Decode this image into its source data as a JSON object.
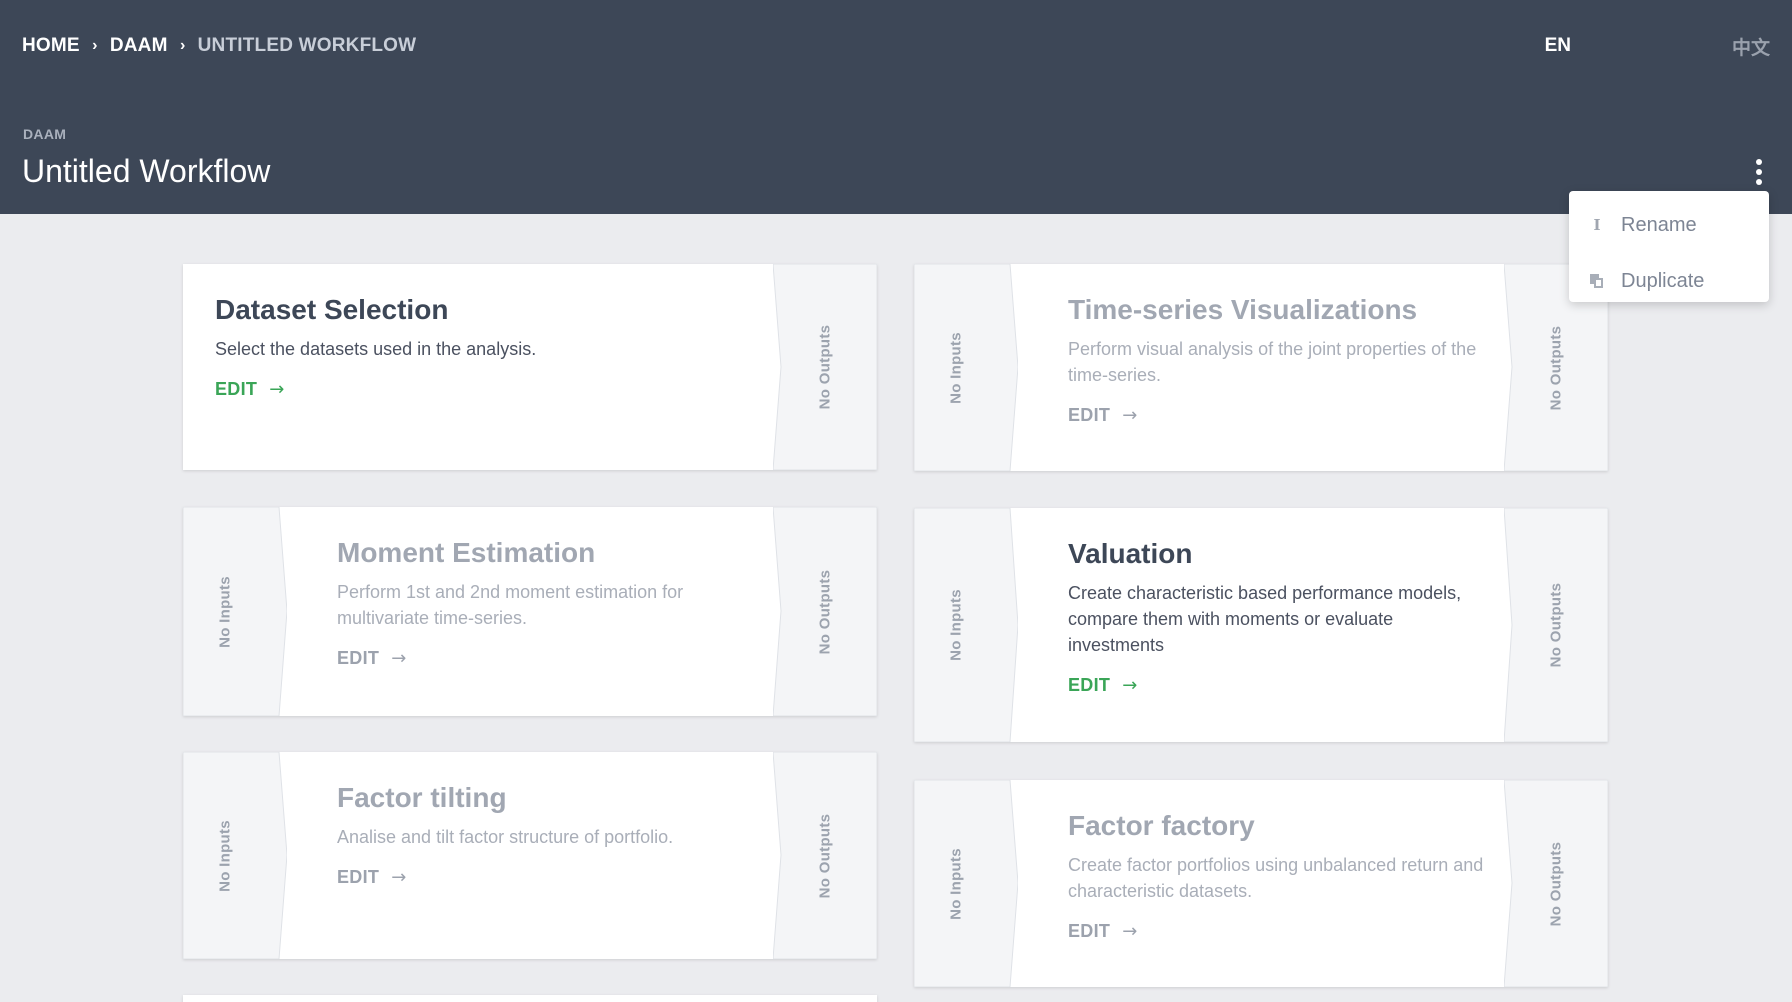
{
  "breadcrumb": [
    "HOME",
    "DAAM",
    "UNTITLED WORKFLOW"
  ],
  "languages": {
    "en": "EN",
    "zh": "中文"
  },
  "header": {
    "subtitle": "DAAM",
    "title": "Untitled Workflow"
  },
  "menu": {
    "items": [
      {
        "label": "Rename",
        "icon": "text-cursor-icon"
      },
      {
        "label": "Duplicate",
        "icon": "copy-icon"
      }
    ]
  },
  "cards": [
    {
      "title": "Dataset Selection",
      "description": "Select the datasets used in the analysis.",
      "edit": "EDIT",
      "inputs": "",
      "outputs": "No Outputs",
      "status": "active"
    },
    {
      "title": "Time-series Visualizations",
      "description": "Perform visual analysis of the joint properties of the time-series.",
      "edit": "EDIT",
      "inputs": "No Inputs",
      "outputs": "No Outputs",
      "status": "inactive"
    },
    {
      "title": "Moment Estimation",
      "description": "Perform 1st and 2nd moment estimation for multivariate time-series.",
      "edit": "EDIT",
      "inputs": "No Inputs",
      "outputs": "No Outputs",
      "status": "inactive"
    },
    {
      "title": "Valuation",
      "description": "Create characteristic based performance models, compare them with moments or evaluate investments",
      "edit": "EDIT",
      "inputs": "No Inputs",
      "outputs": "No Outputs",
      "status": "active"
    },
    {
      "title": "Factor tilting",
      "description": "Analise and tilt factor structure of portfolio.",
      "edit": "EDIT",
      "inputs": "No Inputs",
      "outputs": "No Outputs",
      "status": "inactive"
    },
    {
      "title": "Factor factory",
      "description": "Create factor portfolios using unbalanced return and characteristic datasets.",
      "edit": "EDIT",
      "inputs": "No Inputs",
      "outputs": "No Outputs",
      "status": "inactive"
    }
  ],
  "colors": {
    "header": "#3d4757",
    "active_edit": "#3aa557",
    "background": "#ebecef"
  }
}
